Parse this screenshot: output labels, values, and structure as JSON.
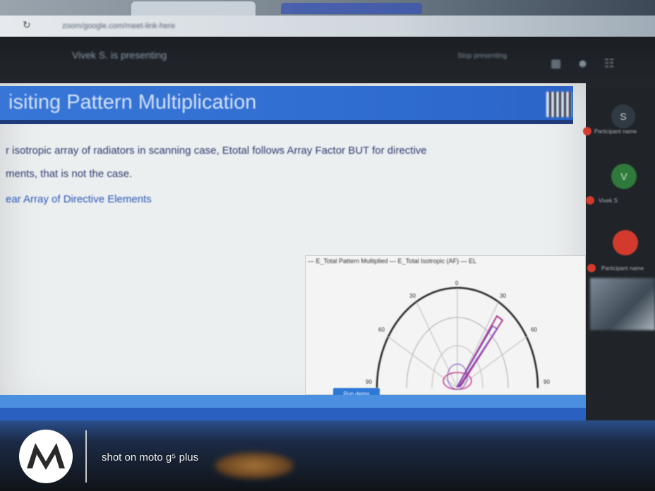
{
  "browser": {
    "url": "zoom/google.com/meet-link-here"
  },
  "meeting": {
    "presenting_banner": "Vivek S. is presenting",
    "stop_presenting": "Stop presenting"
  },
  "slide": {
    "title": "isiting Pattern Multiplication",
    "bullet_1": "r isotropic array of radiators in scanning case, Etotal follows Array Factor BUT for directive",
    "bullet_2": "ments, that is not the case.",
    "bullet_3": "ear Array of Directive Elements"
  },
  "plot": {
    "legend": "— E_Total Pattern Multiplied   — E_Total Isotropic (AF)   — EL",
    "button_label": "Run demo",
    "angle_labels": [
      "0",
      "30",
      "60",
      "90",
      "30",
      "60",
      "90"
    ]
  },
  "participants": {
    "avatar_s": "S",
    "avatar_v": "V",
    "name_1": "Participant name",
    "name_2": "Vivek S",
    "name_3": "Participant name"
  },
  "watermark": {
    "text": "shot on moto g⁵ plus"
  },
  "colors": {
    "slide_title_bar": "#3776d6",
    "moto_logo": "#ffffff"
  }
}
